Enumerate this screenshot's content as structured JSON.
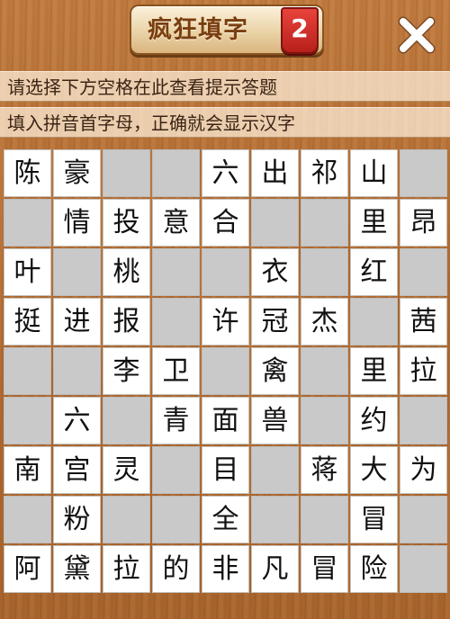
{
  "app": {
    "title": "疯狂填字",
    "version": "2",
    "close_icon": "close-icon"
  },
  "hints": {
    "line1": "请选择下方空格在此查看提示答题",
    "line2": "填入拼音首字母，正确就会显示汉字"
  },
  "colors": {
    "wood": "#b5733a",
    "title_text": "#7a3e10",
    "version_badge": "#d3312a",
    "white_cell": "#ffffff",
    "empty_cell": "#c9c9c9"
  },
  "grid": {
    "rows": 9,
    "cols": 9,
    "cells": [
      [
        "陈",
        "豪",
        "",
        "",
        "六",
        "出",
        "祁",
        "山",
        ""
      ],
      [
        "",
        "情",
        "投",
        "意",
        "合",
        "",
        "",
        "里",
        "昂"
      ],
      [
        "叶",
        "",
        "桃",
        "",
        "",
        "衣",
        "",
        "红",
        ""
      ],
      [
        "挺",
        "进",
        "报",
        "",
        "许",
        "冠",
        "杰",
        "",
        "茜"
      ],
      [
        "",
        "",
        "李",
        "卫",
        "",
        "禽",
        "",
        "里",
        "拉"
      ],
      [
        "",
        "六",
        "",
        "青",
        "面",
        "兽",
        "",
        "约",
        ""
      ],
      [
        "南",
        "宫",
        "灵",
        "",
        "目",
        "",
        "蒋",
        "大",
        "为"
      ],
      [
        "",
        "粉",
        "",
        "",
        "全",
        "",
        "",
        "冒",
        ""
      ],
      [
        "阿",
        "黛",
        "拉",
        "的",
        "非",
        "凡",
        "冒",
        "险",
        ""
      ]
    ]
  }
}
